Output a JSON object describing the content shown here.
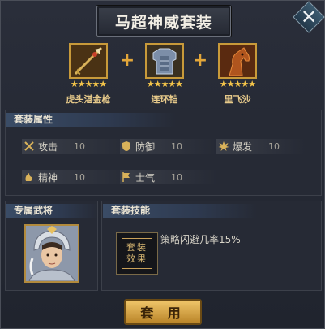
{
  "title": "马超神威套装",
  "close_label": "✕",
  "items": [
    {
      "name": "虎头湛金枪",
      "stars": "★★★★★",
      "icon": "spear-icon"
    },
    {
      "name": "连环铠",
      "stars": "★★★★★",
      "icon": "armor-icon"
    },
    {
      "name": "里飞沙",
      "stars": "★★★★★",
      "icon": "horse-icon"
    }
  ],
  "plus": "+",
  "attributes": {
    "header": "套装属性",
    "stats": [
      {
        "name": "攻击",
        "value": "10",
        "icon": "crossed-swords-icon"
      },
      {
        "name": "防御",
        "value": "10",
        "icon": "shield-icon"
      },
      {
        "name": "爆发",
        "value": "10",
        "icon": "burst-icon"
      },
      {
        "name": "精神",
        "value": "10",
        "icon": "spirit-icon"
      },
      {
        "name": "士气",
        "value": "10",
        "icon": "banner-icon"
      }
    ]
  },
  "general": {
    "header": "专属武将"
  },
  "skill": {
    "header": "套装技能",
    "icon_text_top": "套装",
    "icon_text_bottom": "效果",
    "description": "策略闪避几率15%"
  },
  "apply_label": "套 用",
  "colors": {
    "gold": "#e2a63a",
    "star": "#f6c64a",
    "button": "#f0c66a"
  }
}
